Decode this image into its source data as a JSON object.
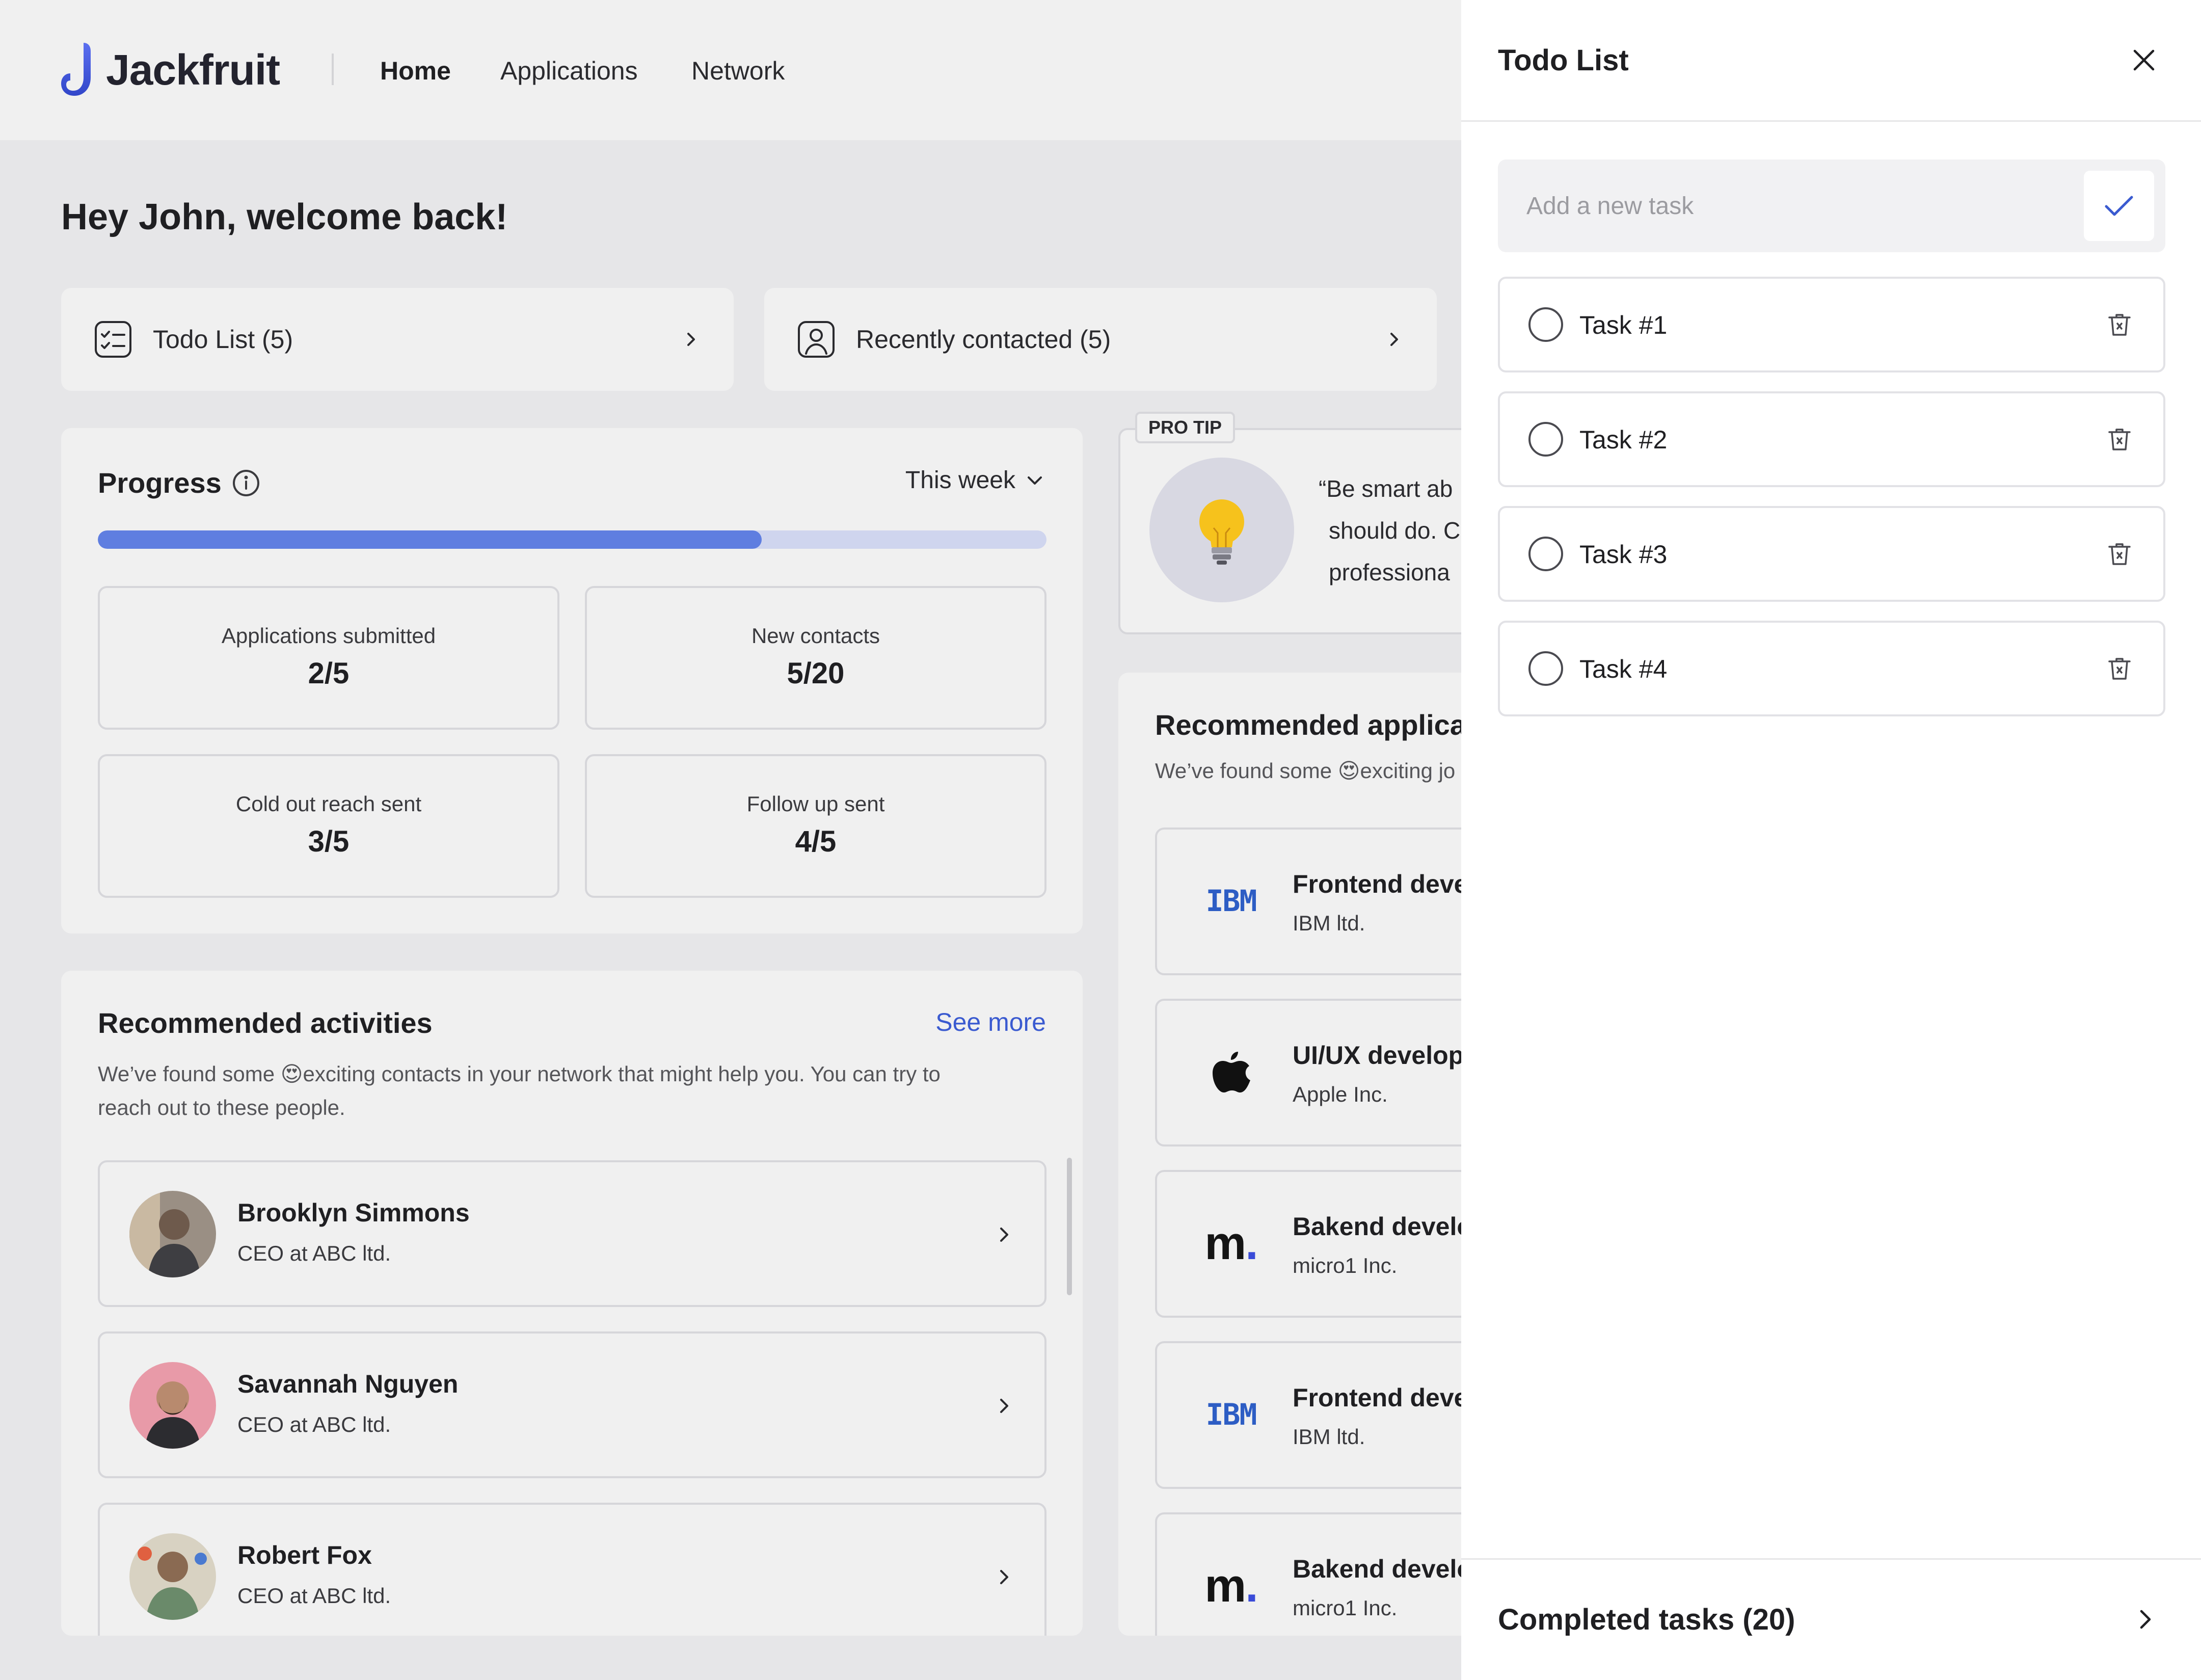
{
  "app": {
    "name": "Jackfruit"
  },
  "nav": {
    "home": "Home",
    "applications": "Applications",
    "network": "Network"
  },
  "greeting": "Hey John, welcome back!",
  "quick_links": {
    "todo": "Todo List (5)",
    "recent": "Recently contacted (5)"
  },
  "progress": {
    "title": "Progress",
    "period": "This week",
    "fraction": 0.7,
    "stats": [
      {
        "label": "Applications submitted",
        "value": "2/5"
      },
      {
        "label": "New contacts",
        "value": "5/20"
      },
      {
        "label": "Cold out reach sent",
        "value": "3/5"
      },
      {
        "label": "Follow up sent",
        "value": "4/5"
      }
    ]
  },
  "activities": {
    "title": "Recommended activities",
    "see_more": "See more",
    "desc_line1": "We’ve found some 😍exciting contacts in your network that might help you. You can try to",
    "desc_line2": "reach out to these people.",
    "contacts": [
      {
        "name": "Brooklyn Simmons",
        "role": "CEO at ABC ltd."
      },
      {
        "name": "Savannah Nguyen",
        "role": "CEO at ABC ltd."
      },
      {
        "name": "Robert Fox",
        "role": "CEO at ABC ltd."
      }
    ]
  },
  "protip": {
    "badge": "PRO TIP",
    "line1": "“Be smart ab",
    "line2": "should do. C",
    "line3": "professiona"
  },
  "applications": {
    "title": "Recommended applicat",
    "desc": "We’ve found some 😍exciting jo",
    "jobs": [
      {
        "logo": "IBM",
        "title": "Frontend deve",
        "company": "IBM ltd."
      },
      {
        "logo": "",
        "title": "UI/UX develop",
        "company": "Apple Inc."
      },
      {
        "logo": "m",
        "title": "Bakend develo",
        "company": "micro1 Inc."
      },
      {
        "logo": "IBM",
        "title": "Frontend deve",
        "company": "IBM ltd."
      },
      {
        "logo": "m",
        "title": "Bakend develo",
        "company": "micro1 Inc."
      }
    ]
  },
  "todo": {
    "title": "Todo List",
    "placeholder": "Add a new task",
    "tasks": [
      {
        "label": "Task #1"
      },
      {
        "label": "Task #2"
      },
      {
        "label": "Task #3"
      },
      {
        "label": "Task #4"
      }
    ],
    "completed": "Completed tasks (20)"
  },
  "colors": {
    "accent": "#5f7ee0",
    "track": "#cfd5ee",
    "link": "#3a5ad0",
    "ibm": "#2d5dc4"
  },
  "icons": {
    "logo": "jackfruit-logo-icon",
    "todo": "checklist-icon",
    "recent": "contact-card-icon",
    "info": "info-icon",
    "bulb": "lightbulb-icon",
    "close": "close-icon",
    "check": "check-icon",
    "trash": "trash-icon",
    "chevron": "chevron-right-icon"
  }
}
